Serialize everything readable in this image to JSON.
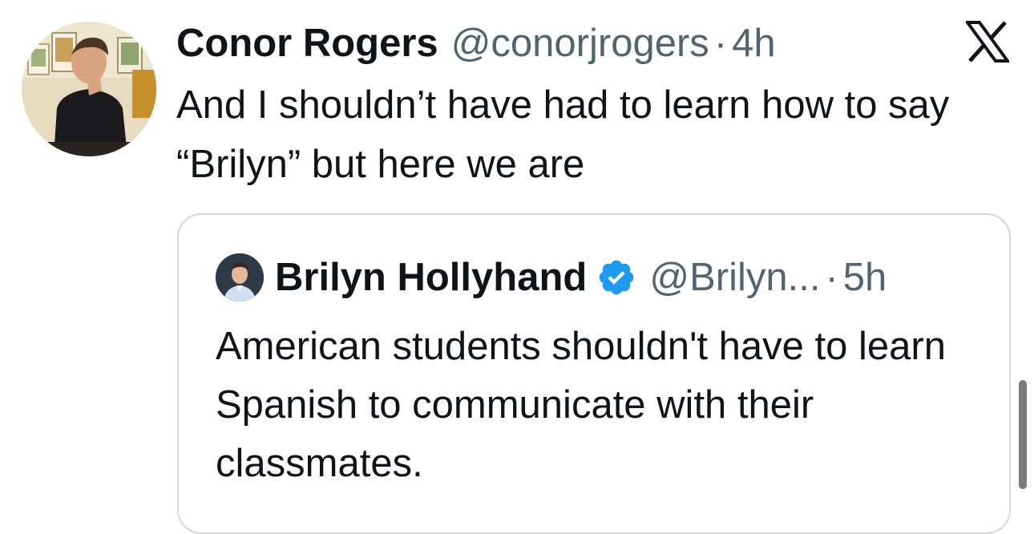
{
  "tweet": {
    "author_name": "Conor Rogers",
    "author_handle": "@conorjrogers",
    "separator": "·",
    "time": "4h",
    "text": "And I shouldn’t have had to learn how to say “Brilyn” but here we are",
    "avatar_icon": "profile-photo",
    "platform_icon": "x-logo-icon"
  },
  "quote": {
    "author_name": "Brilyn Hollyhand",
    "verified": true,
    "verified_icon": "verified-badge-icon",
    "verified_color": "#1d9bf0",
    "author_handle": "@Brilyn...",
    "separator": "·",
    "time": "5h",
    "text": "American students shouldn't have to learn Spanish to communicate with their classmates."
  },
  "colors": {
    "text_primary": "#0f1419",
    "text_secondary": "#536471",
    "card_border": "#cfd9de"
  }
}
